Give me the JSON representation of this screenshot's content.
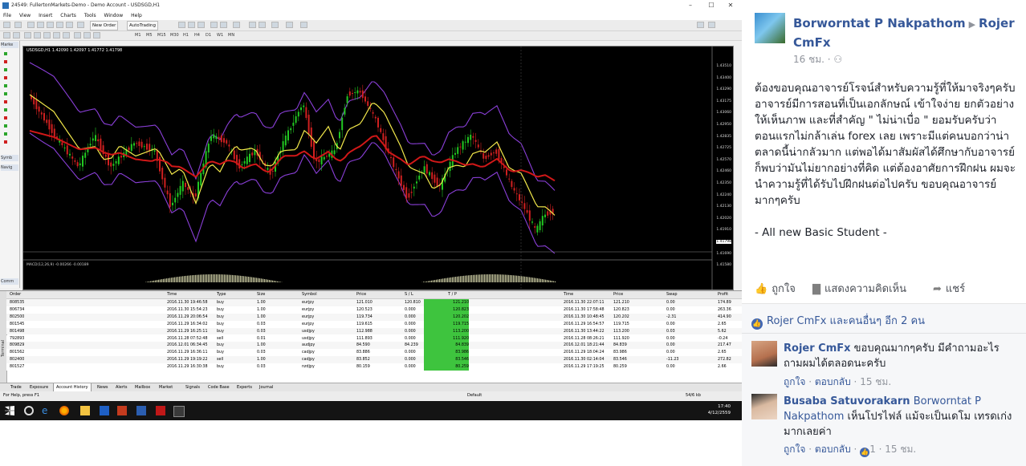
{
  "mt4": {
    "window_title": "24549: FullertonMarkets-Demo - Demo Account - USDSGD,H1",
    "menu": [
      "File",
      "View",
      "Insert",
      "Charts",
      "Tools",
      "Window",
      "Help"
    ],
    "toolbar": {
      "new_order": "New Order",
      "autotrading": "AutoTrading"
    },
    "timeframes": [
      "M1",
      "M5",
      "M15",
      "M30",
      "H1",
      "H4",
      "D1",
      "W1",
      "MN"
    ],
    "side_tabs": {
      "market": "Marke",
      "symbols": "Symb",
      "navigator": "Navig",
      "common": "Comm"
    },
    "chart": {
      "title": "USDSGD,H1",
      "header_label": "USDSGD,H1  1.42090 1.42097 1.41772 1.41798",
      "indicator_label": "MACD(12,26,9) -0.00266 -0.00189",
      "price_labels": [
        "1.43510",
        "1.43400",
        "1.43290",
        "1.43175",
        "1.43060",
        "1.42950",
        "1.42835",
        "1.42725",
        "1.42570",
        "1.42460",
        "1.42350",
        "1.42240",
        "1.42130",
        "1.42020",
        "1.41910",
        "1.41798",
        "1.41690",
        "1.41580"
      ],
      "current_price": "1.41798",
      "colors": {
        "bull": "#22c722",
        "bear": "#d02020",
        "ma_fast": "#f2e84a",
        "ma_slow": "#d11818",
        "band": "#8a3fd8",
        "macd": "#c8c8a0"
      }
    },
    "table": {
      "headers": [
        "Order",
        "Time",
        "Type",
        "Size",
        "Symbol",
        "Price",
        "S / L",
        "T / P",
        "Time",
        "Price",
        "Swap",
        "Profit"
      ],
      "rows": [
        [
          "808535",
          "2016.11.30 19:46:58",
          "buy",
          "1.00",
          "eurjpy",
          "121.010",
          "120.810",
          "121.210",
          "2016.11.30 22:07:11",
          "121.210",
          "0.00",
          "174.89"
        ],
        [
          "806734",
          "2016.11.30 15:54:23",
          "buy",
          "1.00",
          "eurjpy",
          "120.523",
          "0.000",
          "120.823",
          "2016.11.30 17:58:48",
          "120.823",
          "0.00",
          "263.36"
        ],
        [
          "802500",
          "2016.11.29 20:06:54",
          "buy",
          "1.00",
          "eurjpy",
          "119.734",
          "0.000",
          "120.202",
          "2016.11.30 10:48:45",
          "120.202",
          "-2.31",
          "414.90"
        ],
        [
          "801545",
          "2016.11.29 16:34:02",
          "buy",
          "0.03",
          "eurjpy",
          "119.615",
          "0.000",
          "119.715",
          "2016.11.29 16:54:57",
          "119.715",
          "0.00",
          "2.65"
        ],
        [
          "801498",
          "2016.11.29 16:25:11",
          "buy",
          "0.03",
          "usdjpy",
          "112.988",
          "0.000",
          "113.200",
          "2016.11.30 13:44:22",
          "113.200",
          "0.03",
          "5.62"
        ],
        [
          "792893",
          "2016.11.28 07:52:48",
          "sell",
          "0.01",
          "usdjpy",
          "111.893",
          "0.000",
          "111.920",
          "2016.11.28 08:26:21",
          "111.920",
          "0.00",
          "-0.24"
        ],
        [
          "809829",
          "2016.12.01 06:34:45",
          "buy",
          "1.00",
          "audjpy",
          "84.590",
          "84.239",
          "84.839",
          "2016.12.01 18:21:44",
          "84.839",
          "0.00",
          "217.47"
        ],
        [
          "801562",
          "2016.11.29 16:36:11",
          "buy",
          "0.03",
          "cadjpy",
          "83.886",
          "0.000",
          "83.986",
          "2016.11.29 18:04:24",
          "83.986",
          "0.00",
          "2.65"
        ],
        [
          "802400",
          "2016.11.29 19:19:22",
          "sell",
          "1.00",
          "cadjpy",
          "83.852",
          "0.000",
          "83.546",
          "2016.11.30 02:14:04",
          "83.546",
          "-11.23",
          "272.82"
        ],
        [
          "801527",
          "2016.11.29 16:30:38",
          "buy",
          "0.03",
          "nzdjpy",
          "80.159",
          "0.000",
          "80.259",
          "2016.11.29 17:19:25",
          "80.259",
          "0.00",
          "2.66"
        ]
      ],
      "tabs": [
        "Trade",
        "Exposure",
        "Account History",
        "News",
        "Alerts",
        "Mailbox",
        "Market",
        "Signals",
        "Code Base",
        "Experts",
        "Journal"
      ],
      "active_tab": "Account History",
      "side_label": "Terminal"
    },
    "status": {
      "help": "For Help, press F1",
      "profile": "Default",
      "traffic": "54/6 kb"
    },
    "clock": {
      "time": "17:40",
      "date": "4/12/2559"
    }
  },
  "post": {
    "author": "Borworntat P Nakpathom",
    "target": "Rojer CmFx",
    "time": "16 ชม.",
    "text": "ต้องขอบคุณอาจารย์โรจน์สำหรับความรู้ที่ให้มาจริงๆครับ\nอาจารย์มีการสอนที่เป็นเอกลักษณ์ เข้าใจง่าย ยกตัวอย่างให้เห็นภาพ และที่สำคัญ \" ไม่น่าเบื่อ \" ยอมรับครับว่าตอนแรกไม่กล้าเล่น forex เลย เพราะมีแต่คนบอกว่าน่าตลาดนี้น่ากลัวมาก แต่พอได้มาสัมผัสได้ศึกษากับอาจารย์ก็พบว่ามันไม่ยากอย่างที่คิด แต่ต้องอาศัยการฝึกฝน ผมจะนำความรู้ที่ได้รับไปฝึกฝนต่อไปครับ ขอบคุณอาจารย์มากๆครับ\n\n- All new Basic Student -",
    "actions": {
      "like": "ถูกใจ",
      "comment": "แสดงความคิดเห็น",
      "share": "แชร์"
    },
    "likes_summary": "Rojer CmFx และคนอื่นๆ อีก 2 คน",
    "comments": [
      {
        "name": "Rojer CmFx",
        "text": "ขอบคุณมากๆครับ มีคำถามอะไรถามผมได้ตลอดนะครับ",
        "like": "ถูกใจ",
        "reply": "ตอบกลับ",
        "time": "15 ชม."
      },
      {
        "name": "Busaba Satuvorakarn",
        "mention": "Borworntat P Nakpathom",
        "text": "เห็นโปรไฟล์ แม้จะเป็นเดโม เทรดเก่งมากเลยค่า",
        "like": "ถูกใจ",
        "reply": "ตอบกลับ",
        "likes": "1",
        "time": "15 ชม."
      }
    ]
  }
}
